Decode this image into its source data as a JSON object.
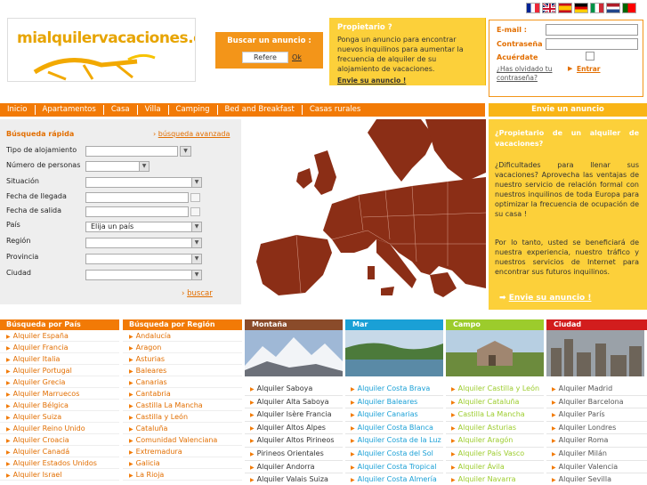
{
  "flags": [
    {
      "icon": "flag-france-icon"
    },
    {
      "icon": "flag-uk-icon"
    },
    {
      "icon": "flag-spain-icon"
    },
    {
      "icon": "flag-germany-icon"
    },
    {
      "icon": "flag-italy-icon"
    },
    {
      "icon": "flag-netherlands-icon"
    },
    {
      "icon": "flag-portugal-icon"
    }
  ],
  "logo": {
    "text": "mialquilervacaciones.es"
  },
  "search": {
    "title": "Buscar un anuncio :",
    "placeholder": "Refere",
    "ok": "Ok"
  },
  "owner_box": {
    "title": "Propietario ?",
    "text": "Ponga un anuncio para encontrar nuevos inquilinos para aumentar la frecuencia de alquiler de su alojamiento de vacaciones.",
    "link": "Envie su anuncio !"
  },
  "login": {
    "email_label": "E-mail :",
    "password_label": "Contraseña :",
    "remember_label": "Acuérdate",
    "forgot": "¿Has olvidado tu contraseña?",
    "enter": "Entrar"
  },
  "nav": [
    "Inicio",
    "Apartamentos",
    "Casa",
    "Villa",
    "Camping",
    "Bed and Breakfast",
    "Casas rurales"
  ],
  "announce_tab": "Envie un anuncio",
  "quick": {
    "title": "Búsqueda rápida",
    "advanced": "búsqueda avanzada",
    "labels": [
      "Tipo de alojamiento",
      "Número de personas",
      "Situación",
      "Fecha de llegada",
      "Fecha de salida",
      "País",
      "Región",
      "Provincia",
      "Ciudad"
    ],
    "country_value": "Elija un país",
    "submit": "buscar"
  },
  "owner_col": {
    "heading": "¿Propietario de un alquiler de vacaciones?",
    "p1": "¿Dificultades para llenar sus vacaciones? Aprovecha las ventajas de nuestro servicio de relación formal con nuestros inquilinos de toda Europa para optimizar la frecuencia de ocupación de su casa !",
    "p2": "Por lo tanto, usted se beneficiará de nuestra experiencia, nuestro tráfico y nuestros servicios de Internet para encontrar sus futuros inquilinos.",
    "cta": "Envie su anuncio !"
  },
  "by_country": {
    "title": "Búsqueda por País",
    "items": [
      "Alquiler España",
      "Alquiler Francia",
      "Alquiler Italia",
      "Alquiler Portugal",
      "Alquiler Grecia",
      "Alquiler Marruecos",
      "Alquiler Bélgica",
      "Alquiler Suiza",
      "Alquiler Reino Unido",
      "Alquiler Croacia",
      "Alquiler Canadá",
      "Alquiler Estados Unidos",
      "Alquiler Israel"
    ]
  },
  "by_region": {
    "title": "Búsqueda por Región",
    "items": [
      "Andalucía",
      "Aragon",
      "Asturias",
      "Baleares",
      "Canarias",
      "Cantabria",
      "Castilla La Mancha",
      "Castilla y León",
      "Cataluña",
      "Comunidad Valenciana",
      "Extremadura",
      "Galicia",
      "La Rioja"
    ]
  },
  "montana": {
    "title": "Montaña",
    "color": "#8a4b2a",
    "items": [
      "Alquiler Saboya",
      "Alquiler Alta Saboya",
      "Alquiler Isère Francia",
      "Alquiler Altos Alpes",
      "Alquiler Altos Pirineos",
      "Pirineos Orientales",
      "Alquiler Andorra",
      "Alquiler Valais Suiza"
    ]
  },
  "mar": {
    "title": "Mar",
    "color": "#1aa0d6",
    "items": [
      "Alquiler Costa Brava",
      "Alquiler Baleares",
      "Alquiler Canarias",
      "Alquiler Costa Blanca",
      "Alquiler Costa de la Luz",
      "Alquiler Costa del Sol",
      "Alquiler Costa Tropical",
      "Alquiler Costa Almería"
    ]
  },
  "campo": {
    "title": "Campo",
    "color": "#9ccc2c",
    "items": [
      "Alquiler Castilla y León",
      "Alquiler Cataluña",
      "Castilla La Mancha",
      "Alquiler Asturias",
      "Alquiler Aragón",
      "Alquiler País Vasco",
      "Alquiler Ávila",
      "Alquiler Navarra"
    ]
  },
  "ciudad": {
    "title": "Ciudad",
    "color": "#d21d1d",
    "items": [
      "Alquiler Madrid",
      "Alquiler Barcelona",
      "Alquiler París",
      "Alquiler Londres",
      "Alquiler Roma",
      "Alquiler Milán",
      "Alquiler Valencia",
      "Alquiler Sevilla"
    ]
  }
}
